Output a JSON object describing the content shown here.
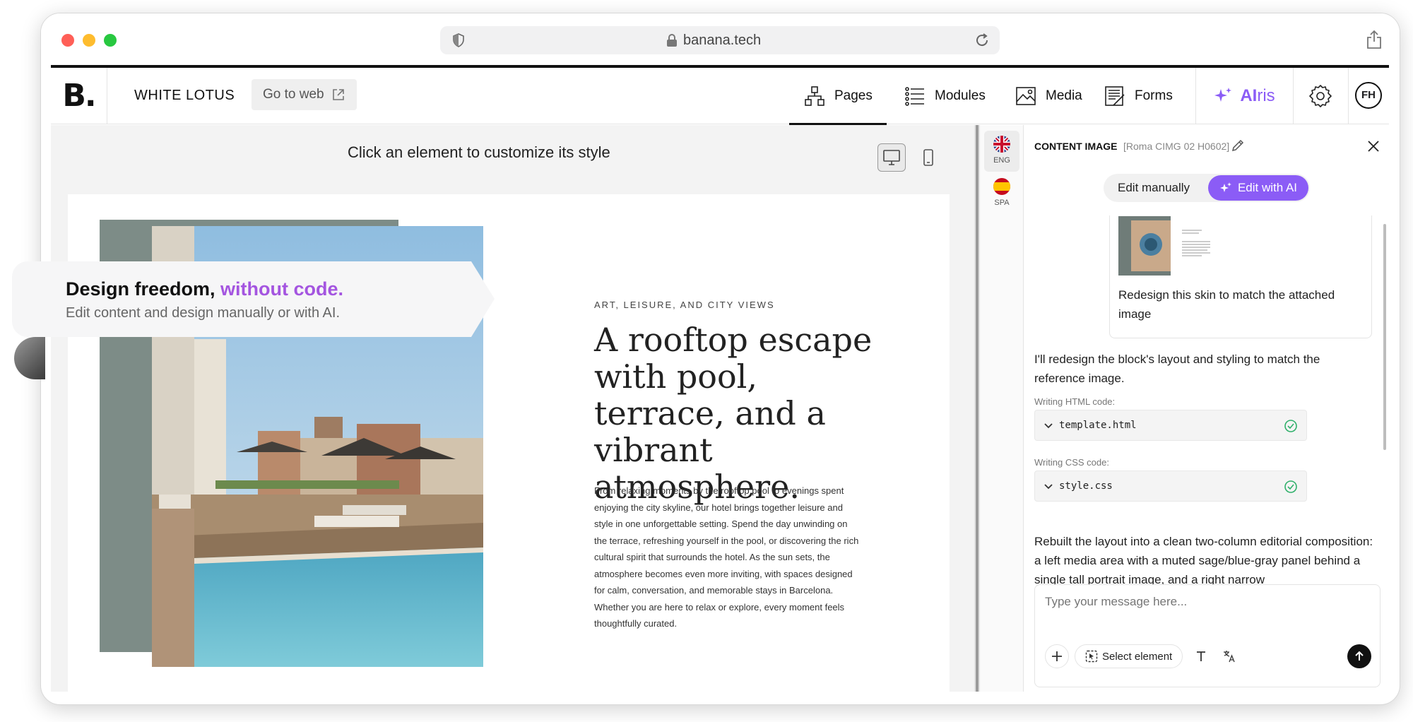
{
  "browser": {
    "url": "banana.tech"
  },
  "topnav": {
    "logo": "B.",
    "site_name": "WHITE LOTUS",
    "go_to_web": "Go to web",
    "items": [
      {
        "label": "Pages",
        "icon": "sitemap-icon",
        "active": true
      },
      {
        "label": "Modules",
        "icon": "list-icon",
        "active": false
      },
      {
        "label": "Media",
        "icon": "image-icon",
        "active": false
      },
      {
        "label": "Forms",
        "icon": "form-icon",
        "active": false
      }
    ],
    "airis_prefix": "AI",
    "airis_suffix": "ris",
    "user_initials": "FH"
  },
  "canvas": {
    "hint": "Click an element to customize its style",
    "selected_device": "desktop"
  },
  "preview": {
    "eyebrow": "ART, LEISURE, AND CITY VIEWS",
    "headline": "A rooftop escape with pool, terrace, and a vibrant atmosphere.",
    "body": "From relaxing moments by the rooftop pool to evenings spent enjoying the city skyline, our hotel brings together leisure and style in one unforgettable setting. Spend the day unwinding on the terrace, refreshing yourself in the pool, or discovering the rich cultural spirit that surrounds the hotel. As the sun sets, the atmosphere becomes even more inviting, with spaces designed for calm, conversation, and memorable stays in Barcelona. Whether you are here to relax or explore, every moment feels thoughtfully curated."
  },
  "languages": [
    {
      "code": "ENG",
      "icon": "uk-flag-icon",
      "active": true
    },
    {
      "code": "SPA",
      "icon": "spain-flag-icon",
      "active": false
    }
  ],
  "panel": {
    "title": "CONTENT IMAGE",
    "subtitle": "[Roma CIMG 02 H0602]",
    "mode_manual": "Edit manually",
    "mode_ai": "Edit with AI",
    "user_message": "Redesign this skin to match the attached image",
    "assistant_intro": "I'll redesign the block's layout and styling to match the reference image.",
    "html_label": "Writing HTML code:",
    "html_file": "template.html",
    "css_label": "Writing CSS code:",
    "css_file": "style.css",
    "assistant_summary": "Rebuilt the layout into a clean two-column editorial composition: a left media area with a muted sage/blue-gray panel behind a single tall portrait image, and a right narrow",
    "composer_placeholder": "Type your message here...",
    "select_element": "Select element"
  },
  "callout": {
    "title_main": "Design freedom, ",
    "title_accent": "without code.",
    "subtitle": "Edit content and design manually or with AI."
  },
  "colors": {
    "accent": "#8b5cf6",
    "callout_accent": "#a455e0",
    "sage_panel": "#7d8c87"
  }
}
